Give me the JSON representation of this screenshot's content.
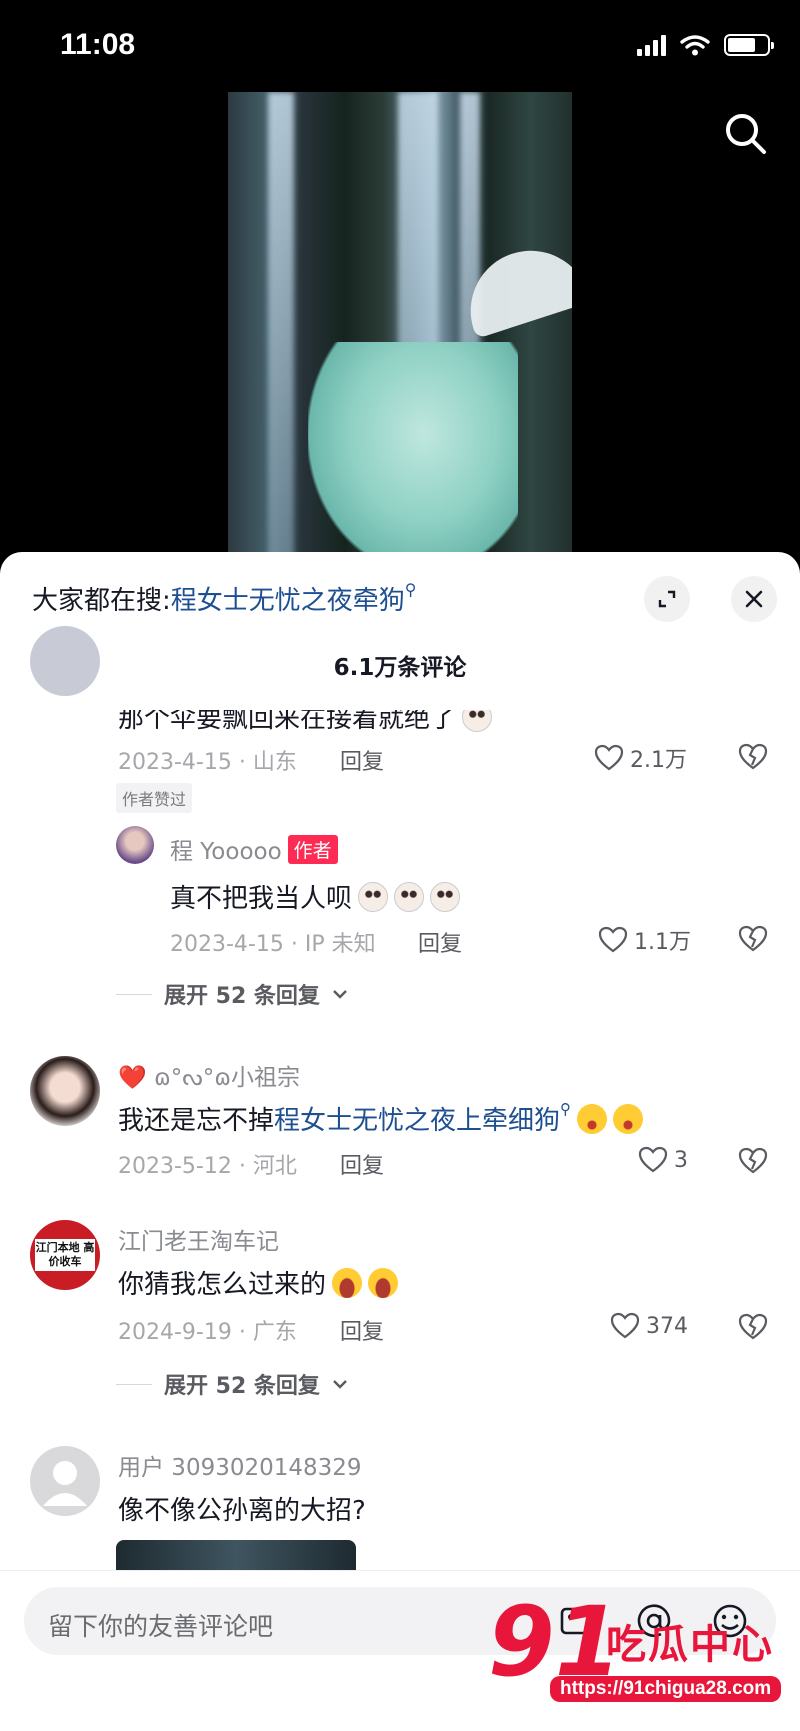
{
  "status_bar": {
    "time": "11:08"
  },
  "panel": {
    "hot_search_label": "大家都在搜:",
    "hot_search_term": "程女士无忧之夜牵狗",
    "comment_count": "6.1万条评论"
  },
  "comments": [
    {
      "text": "那个伞要飘回来在接着就绝了",
      "date_location": "2023-4-15 · 山东",
      "reply_label": "回复",
      "likes": "2.1万",
      "tag": "作者赞过",
      "sub_reply": {
        "username": "程 Yooooo",
        "badge": "作者",
        "text": "真不把我当人呗",
        "date_location": "2023-4-15 · IP 未知",
        "reply_label": "回复",
        "likes": "1.1万"
      },
      "expand_label": "展开 52 条回复"
    },
    {
      "username": "❤️ ɷ°ᔓ°ɷ小祖宗",
      "text_prefix": "我还是忘不掉",
      "text_link": "程女士无忧之夜上牵细狗",
      "date_location": "2023-5-12 · 河北",
      "reply_label": "回复",
      "likes": "3"
    },
    {
      "username": "江门老王淘车记",
      "avatar_text": "江门本地 高价收车",
      "text": "你猜我怎么过来的",
      "date_location": "2024-9-19 · 广东",
      "reply_label": "回复",
      "likes": "374",
      "expand_label": "展开 52 条回复"
    },
    {
      "username": "用户 3093020148329",
      "text": "像不像公孙离的大招?"
    }
  ],
  "input": {
    "placeholder": "留下你的友善评论吧"
  },
  "watermark": {
    "number": "91",
    "name": "吃瓜中心",
    "url": "https://91chigua28.com"
  }
}
